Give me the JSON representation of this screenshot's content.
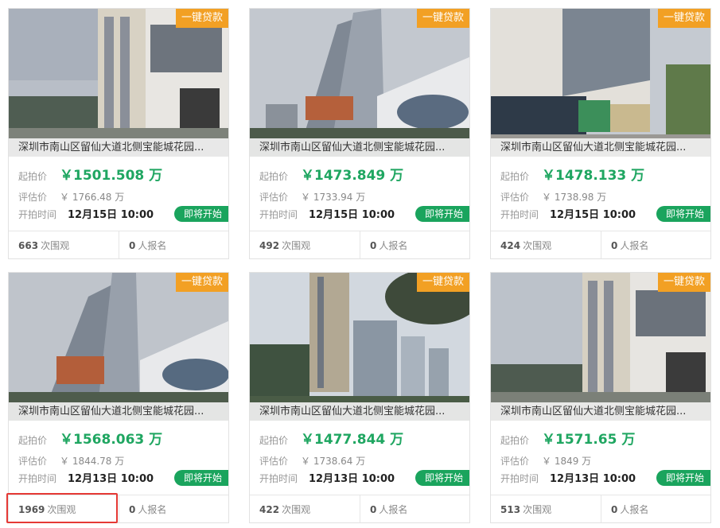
{
  "labels": {
    "start_price": "起拍价",
    "estimate": "评估价",
    "start_time": "开拍时间",
    "views_suffix": "次围观",
    "signups_suffix": "人报名",
    "loan_tag": "一键贷款",
    "status": "即将开始"
  },
  "colors": {
    "price_green": "#1fa661",
    "loan_orange": "#f2a024",
    "status_green": "#1aa45d",
    "highlight_red": "#e53935"
  },
  "listings": [
    {
      "title": "深圳市南山区留仙大道北侧宝能城花园...",
      "start_price": "￥1501.508 万",
      "estimate": "￥ 1766.48 万",
      "start_time": "12月15日 10:00",
      "views": "663",
      "signups": "0"
    },
    {
      "title": "深圳市南山区留仙大道北侧宝能城花园...",
      "start_price": "￥1473.849 万",
      "estimate": "￥ 1733.94 万",
      "start_time": "12月15日 10:00",
      "views": "492",
      "signups": "0"
    },
    {
      "title": "深圳市南山区留仙大道北侧宝能城花园...",
      "start_price": "￥1478.133 万",
      "estimate": "￥ 1738.98 万",
      "start_time": "12月15日 10:00",
      "views": "424",
      "signups": "0"
    },
    {
      "title": "深圳市南山区留仙大道北侧宝能城花园...",
      "start_price": "￥1568.063 万",
      "estimate": "￥ 1844.78 万",
      "start_time": "12月13日 10:00",
      "views": "1969",
      "signups": "0"
    },
    {
      "title": "深圳市南山区留仙大道北侧宝能城花园...",
      "start_price": "￥1477.844 万",
      "estimate": "￥ 1738.64 万",
      "start_time": "12月13日 10:00",
      "views": "422",
      "signups": "0"
    },
    {
      "title": "深圳市南山区留仙大道北侧宝能城花园...",
      "start_price": "￥1571.65 万",
      "estimate": "￥ 1849 万",
      "start_time": "12月13日 10:00",
      "views": "513",
      "signups": "0"
    }
  ]
}
